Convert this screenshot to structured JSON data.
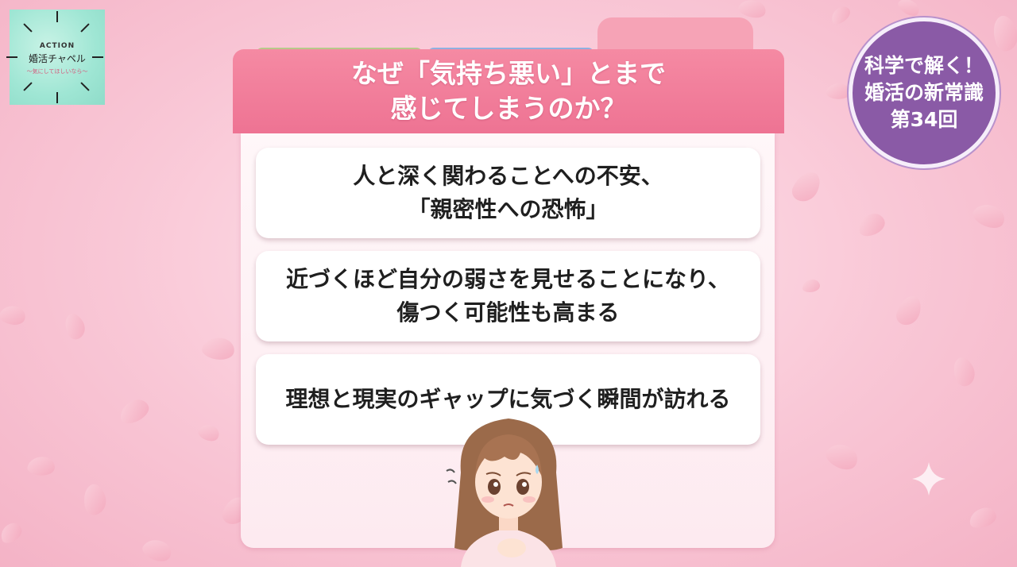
{
  "logo": {
    "top": "ACTION",
    "main": "婚活チャペル",
    "sub": "〜気にしてほしいなら〜"
  },
  "badge": {
    "line1": "科学で解く！",
    "line2": "婚活の新常識",
    "line3": "第34回"
  },
  "header": {
    "line1": "なぜ「気持ち悪い」とまで",
    "line2": "感じてしまうのか？"
  },
  "items": [
    {
      "line1": "人と深く関わることへの不安、",
      "line2": "「親密性への恐怖」"
    },
    {
      "line1": "近づくほど自分の弱さを見せることになり、",
      "line2": "傷つく可能性も高まる"
    },
    {
      "line1": "理想と現実のギャップに気づく瞬間が訪れる",
      "line2": ""
    }
  ],
  "colors": {
    "header": "#ee7393",
    "badge": "#8a5aa6",
    "logo": "#9fe6d4",
    "background": "#f9c7d6"
  }
}
